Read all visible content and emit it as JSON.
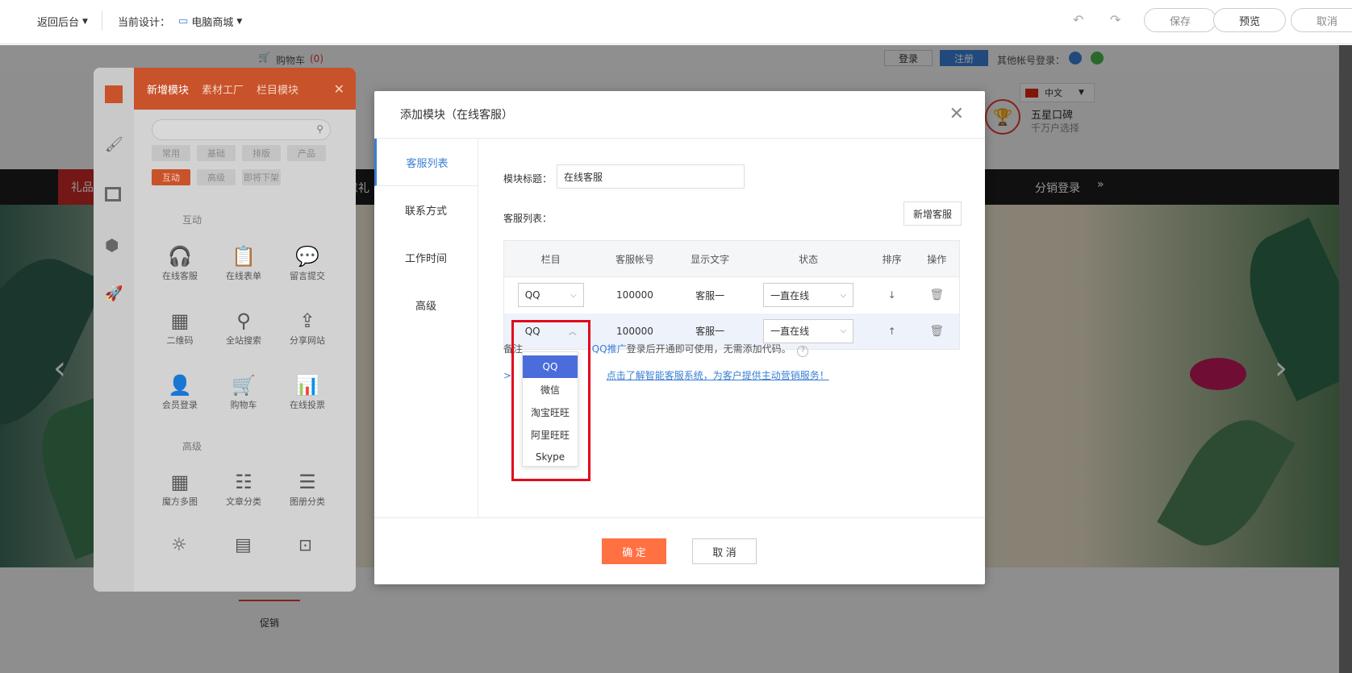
{
  "toolbar": {
    "back_label": "返回后台",
    "design_prefix": "当前设计：",
    "design_name": "电脑商城",
    "save": "保存",
    "preview": "预览",
    "cancel": "取消"
  },
  "site": {
    "cart": "购物车",
    "cart_count": "(0)",
    "login": "登录",
    "register": "注册",
    "other_login": "其他帐号登录：",
    "lang": "中文",
    "badge_title": "五星口碑",
    "badge_sub": "千万户选择",
    "nav_left": "礼品",
    "nav_mid": "意礼",
    "nav_right": "分销登录",
    "promo_tab": "促销"
  },
  "editor": {
    "tabs": [
      "新增模块",
      "素材工厂",
      "栏目模块"
    ],
    "filters": [
      "常用",
      "基础",
      "排版",
      "产品",
      "互动",
      "高级",
      "即将下架"
    ],
    "section1": "互动",
    "section2": "高级",
    "items1": [
      "在线客服",
      "在线表单",
      "留言提交",
      "二维码",
      "全站搜索",
      "分享网站",
      "会员登录",
      "购物车",
      "在线投票"
    ],
    "items2": [
      "魔方多图",
      "文章分类",
      "图册分类"
    ]
  },
  "modal": {
    "title": "添加模块（在线客服）",
    "side_tabs": [
      "客服列表",
      "联系方式",
      "工作时间",
      "高级"
    ],
    "module_title_label": "模块标题：",
    "module_title_value": "在线客服",
    "list_label": "客服列表：",
    "add_btn": "新增客服",
    "columns": [
      "栏目",
      "客服帐号",
      "显示文字",
      "状态",
      "排序",
      "操作"
    ],
    "rows": [
      {
        "type": "QQ",
        "account": "100000",
        "display": "客服一",
        "status": "一直在线",
        "sort": "↓"
      },
      {
        "type": "QQ",
        "account": "100000",
        "display": "客服一",
        "status": "一直在线",
        "sort": "↑"
      }
    ],
    "note_prefix": "备注",
    "note_link": "QQ推广",
    "note_rest": "登录后开通即可使用，无需添加代码。",
    "promo_link": "点击了解智能客服系统，为客户提供主动营销服务！",
    "ok": "确 定",
    "cancel": "取 消"
  },
  "dropdown": {
    "options": [
      "QQ",
      "微信",
      "淘宝旺旺",
      "阿里旺旺",
      "Skype"
    ],
    "selected": "QQ"
  }
}
